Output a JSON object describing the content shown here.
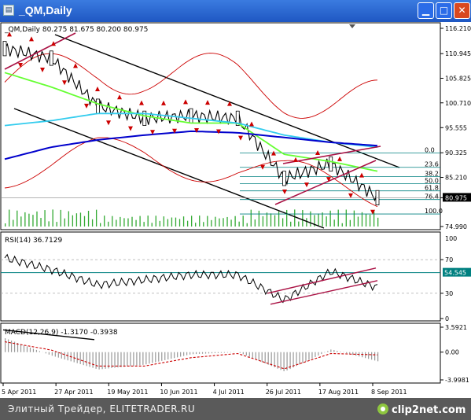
{
  "window": {
    "title": "_QM,Daily",
    "app_icon": "chart-window-icon",
    "buttons": [
      "minimize",
      "maximize",
      "close"
    ]
  },
  "price_panel": {
    "header": "_QM,Daily  80.275 81.675 80.200 80.975",
    "y_ticks": [
      "116.210",
      "110.945",
      "105.825",
      "100.710",
      "95.555",
      "90.325",
      "85.210",
      "80.975",
      "74.990"
    ],
    "current_price": "80.975",
    "fib_levels": [
      "0.0",
      "23.6",
      "38.2",
      "50.0",
      "61.8",
      "76.4",
      "100.0"
    ]
  },
  "rsi_panel": {
    "header": "RSI(14) 36.7129",
    "y_ticks": [
      "70",
      "30",
      "0"
    ],
    "top_tick": "100",
    "level_value": "54.545"
  },
  "macd_panel": {
    "header": "MACD(12,26,9) -1.3170 -0.3938",
    "y_ticks": [
      "3.5921",
      "0.00",
      "-3.9981"
    ]
  },
  "x_axis": [
    "5 Apr 2011",
    "27 Apr 2011",
    "19 May 2011",
    "10 Jun 2011",
    "4 Jul 2011",
    "26 Jul 2011",
    "17 Aug 2011",
    "8 Sep 2011"
  ],
  "footer": {
    "credit": "Элитный Трейдер, ELITETRADER.RU",
    "logo": "clip2net.com"
  },
  "colors": {
    "title_bar": "#2160c8",
    "bollinger": "#cc0000",
    "ma_fast": "#66ff33",
    "ma_mid": "#33ccee",
    "ma_slow": "#0000cc",
    "fib": "#008080",
    "rsi_level": "#008080",
    "macd_signal": "#cc0000",
    "arrows": "#cc0000"
  },
  "chart_data": [
    {
      "type": "candlestick",
      "title": "_QM,Daily",
      "ylim": [
        74.99,
        116.21
      ],
      "x": [
        "5 Apr 2011",
        "27 Apr 2011",
        "19 May 2011",
        "10 Jun 2011",
        "4 Jul 2011",
        "26 Jul 2011",
        "17 Aug 2011",
        "8 Sep 2011"
      ],
      "close": [
        112.0,
        110.0,
        100.0,
        97.5,
        98.0,
        97.5,
        85.0,
        88.0,
        80.975
      ],
      "last": {
        "open": 80.275,
        "high": 81.675,
        "low": 80.2,
        "close": 80.975
      },
      "series": [
        {
          "name": "MA fast",
          "values": [
            107.0,
            104.0,
            100.5,
            98.0,
            96.5,
            96.5,
            90.0,
            88.5,
            86.5
          ]
        },
        {
          "name": "MA mid",
          "values": [
            96.0,
            97.0,
            98.5,
            98.5,
            97.5,
            96.5,
            94.0,
            92.5,
            91.5
          ]
        },
        {
          "name": "MA slow",
          "values": [
            89.0,
            91.5,
            93.0,
            94.0,
            94.8,
            94.5,
            93.5,
            92.5,
            91.8
          ]
        }
      ],
      "fibonacci": {
        "0.0": 90.3,
        "23.6": 87.3,
        "38.2": 85.4,
        "50.0": 83.9,
        "61.8": 82.4,
        "76.4": 80.6,
        "100.0": 77.6
      }
    },
    {
      "type": "line",
      "title": "RSI(14) 36.7129",
      "ylim": [
        0,
        100
      ],
      "levels": [
        30,
        54.545,
        70
      ],
      "x": [
        "5 Apr 2011",
        "27 Apr 2011",
        "19 May 2011",
        "10 Jun 2011",
        "4 Jul 2011",
        "26 Jul 2011",
        "17 Aug 2011",
        "8 Sep 2011"
      ],
      "values": [
        72,
        58,
        40,
        46,
        52,
        52,
        22,
        56,
        36.7129
      ]
    },
    {
      "type": "bar",
      "title": "MACD(12,26,9) -1.3170 -0.3938",
      "ylim": [
        -3.9981,
        3.5921
      ],
      "x": [
        "5 Apr 2011",
        "27 Apr 2011",
        "19 May 2011",
        "10 Jun 2011",
        "4 Jul 2011",
        "26 Jul 2011",
        "17 Aug 2011",
        "8 Sep 2011"
      ],
      "values": [
        2.0,
        -0.5,
        -2.5,
        -1.8,
        -0.3,
        0.0,
        -2.8,
        0.4,
        -1.317
      ],
      "signal": [
        1.5,
        0.3,
        -2.0,
        -2.0,
        -0.8,
        -0.2,
        -2.4,
        -0.2,
        -0.3938
      ]
    }
  ]
}
